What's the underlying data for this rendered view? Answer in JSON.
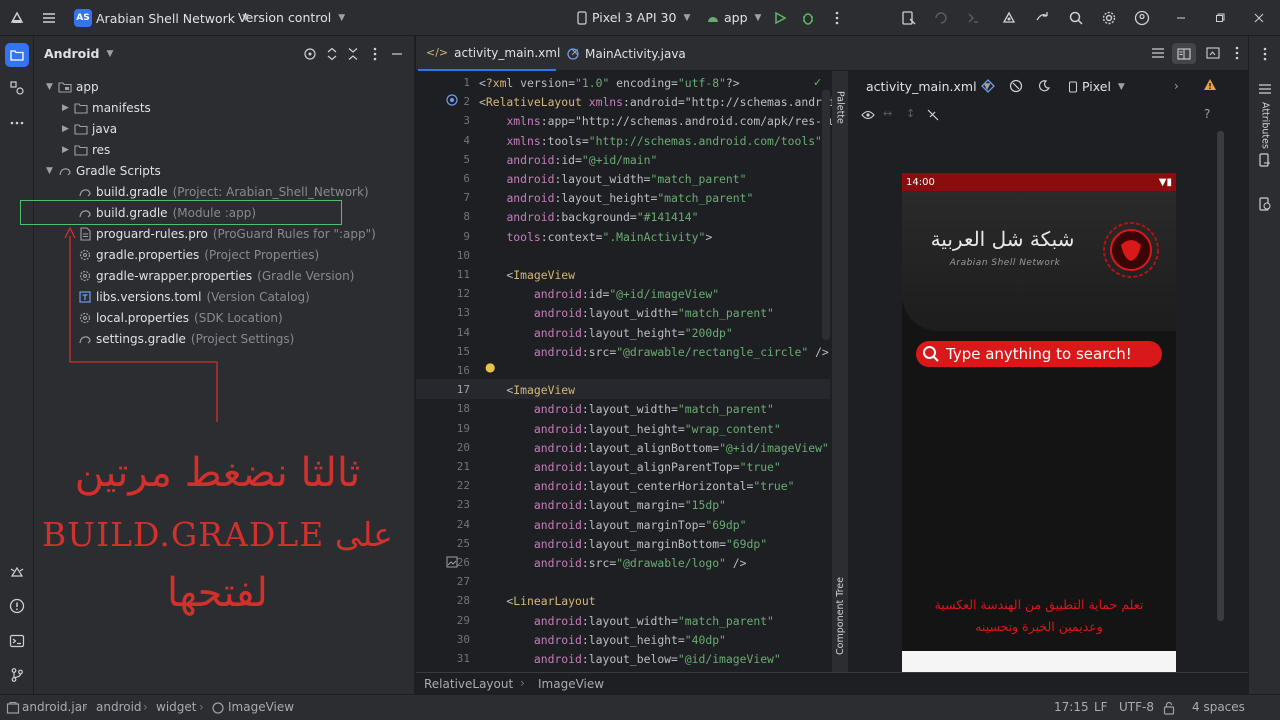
{
  "titlebar": {
    "project_badge": "AS",
    "project_name": "Arabian Shell Network",
    "vcs": "Version control",
    "device": "Pixel 3 API 30",
    "run_config": "app"
  },
  "project_panel": {
    "title": "Android",
    "items": [
      {
        "label": "app",
        "hint": ""
      },
      {
        "label": "manifests",
        "hint": ""
      },
      {
        "label": "java",
        "hint": ""
      },
      {
        "label": "res",
        "hint": ""
      },
      {
        "label": "Gradle Scripts",
        "hint": ""
      },
      {
        "label": "build.gradle",
        "hint": "(Project: Arabian_Shell_Network)"
      },
      {
        "label": "build.gradle",
        "hint": "(Module :app)"
      },
      {
        "label": "proguard-rules.pro",
        "hint": "(ProGuard Rules for \":app\")"
      },
      {
        "label": "gradle.properties",
        "hint": "(Project Properties)"
      },
      {
        "label": "gradle-wrapper.properties",
        "hint": "(Gradle Version)"
      },
      {
        "label": "libs.versions.toml",
        "hint": "(Version Catalog)"
      },
      {
        "label": "local.properties",
        "hint": "(SDK Location)"
      },
      {
        "label": "settings.gradle",
        "hint": "(Project Settings)"
      }
    ]
  },
  "annotation": {
    "line1": "ثالثا نضغط مرتين",
    "line2": "على BUILD.GRADLE",
    "line3": "لفتحها"
  },
  "editor": {
    "tabs": [
      {
        "label": "activity_main.xml"
      },
      {
        "label": "MainActivity.java"
      }
    ],
    "line_numbers": [
      "1",
      "2",
      "3",
      "4",
      "5",
      "6",
      "7",
      "8",
      "9",
      "10",
      "11",
      "12",
      "13",
      "14",
      "15",
      "16",
      "17",
      "18",
      "19",
      "20",
      "21",
      "22",
      "23",
      "24",
      "25",
      "26",
      "27",
      "28",
      "29",
      "30",
      "31"
    ],
    "lines": [
      "<?xml version=\"1.0\" encoding=\"utf-8\"?>",
      "<RelativeLayout xmlns:android=\"http://schemas.android",
      "    xmlns:app=\"http://schemas.android.com/apk/res-aut",
      "    xmlns:tools=\"http://schemas.android.com/tools\"",
      "    android:id=\"@+id/main\"",
      "    android:layout_width=\"match_parent\"",
      "    android:layout_height=\"match_parent\"",
      "    android:background=\"#141414\"",
      "    tools:context=\".MainActivity\">",
      "",
      "    <ImageView",
      "        android:id=\"@+id/imageView\"",
      "        android:layout_width=\"match_parent\"",
      "        android:layout_height=\"200dp\"",
      "        android:src=\"@drawable/rectangle_circle\" />",
      "",
      "    <ImageView",
      "        android:layout_width=\"match_parent\"",
      "        android:layout_height=\"wrap_content\"",
      "        android:layout_alignBottom=\"@+id/imageView\"",
      "        android:layout_alignParentTop=\"true\"",
      "        android:layout_centerHorizontal=\"true\"",
      "        android:layout_margin=\"15dp\"",
      "        android:layout_marginTop=\"69dp\"",
      "        android:layout_marginBottom=\"69dp\"",
      "        android:src=\"@drawable/logo\" />",
      "",
      "    <LinearLayout",
      "        android:layout_width=\"match_parent\"",
      "        android:layout_height=\"40dp\"",
      "        android:layout_below=\"@id/imageView\""
    ],
    "breadcrumb": [
      "RelativeLayout",
      "ImageView"
    ]
  },
  "preview": {
    "file": "activity_main.xml",
    "device": "Pixel",
    "palette_label": "Palette",
    "component_tree_label": "Component Tree",
    "attributes_label": "Attributes",
    "phone": {
      "time": "14:00",
      "logo_arabic": "شبكة شل العربية",
      "logo_english": "Arabian Shell Network",
      "search_placeholder": "Type anything to search!",
      "footer_line1": "تعلم حماية التطبيق من الهندسة العكسية",
      "footer_line2": "وعديمين الخبرة وتحسينه"
    }
  },
  "statusbar": {
    "path": [
      "android.jar",
      "android",
      "widget",
      "ImageView"
    ],
    "position": "17:15",
    "line_sep": "LF",
    "encoding": "UTF-8",
    "indent": "4 spaces"
  },
  "colors": {
    "accent": "#3574f0",
    "annotation_red": "#d0312d",
    "highlight_box": "#4fbf6b",
    "phone_red": "#d9181a"
  }
}
